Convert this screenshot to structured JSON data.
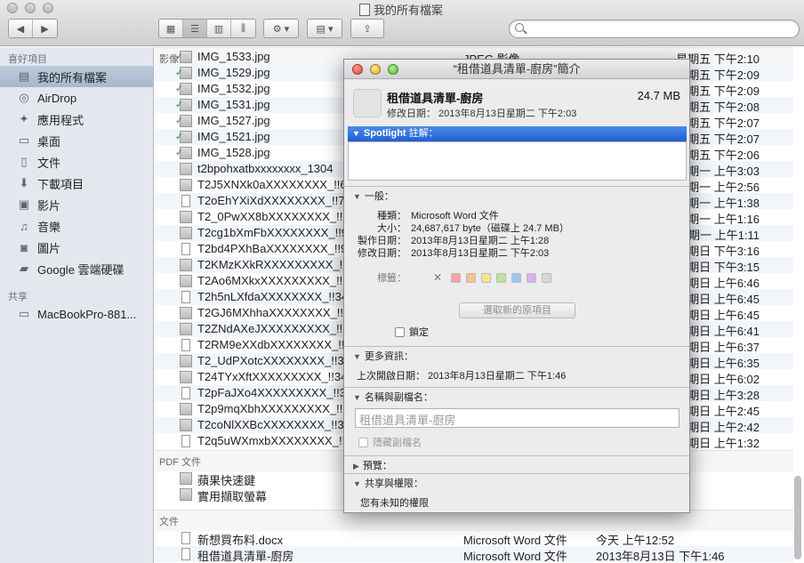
{
  "window": {
    "title": "我的所有檔案"
  },
  "sidebar": {
    "favorites_header": "喜好項目",
    "favorites": [
      {
        "label": "我的所有檔案",
        "icon": "all-files-icon",
        "selected": true
      },
      {
        "label": "AirDrop",
        "icon": "airdrop-icon"
      },
      {
        "label": "應用程式",
        "icon": "applications-icon"
      },
      {
        "label": "桌面",
        "icon": "desktop-icon"
      },
      {
        "label": "文件",
        "icon": "documents-icon"
      },
      {
        "label": "下載項目",
        "icon": "downloads-icon"
      },
      {
        "label": "影片",
        "icon": "movies-icon"
      },
      {
        "label": "音樂",
        "icon": "music-icon"
      },
      {
        "label": "圖片",
        "icon": "pictures-icon"
      },
      {
        "label": "Google 雲端硬碟",
        "icon": "folder-icon"
      }
    ],
    "shared_header": "共享",
    "shared": [
      {
        "label": "MacBookPro-881...",
        "icon": "computer-icon"
      }
    ]
  },
  "list": {
    "images_section": "影像",
    "image_rows": [
      {
        "name": "IMG_1533.jpg",
        "kind": "JPEG 影像",
        "date": "星期五 下午2:10"
      },
      {
        "name": "IMG_1529.jpg",
        "date": "星期五 下午2:09"
      },
      {
        "name": "IMG_1532.jpg",
        "date": "星期五 下午2:09"
      },
      {
        "name": "IMG_1531.jpg",
        "date": "星期五 下午2:08"
      },
      {
        "name": "IMG_1527.jpg",
        "date": "星期五 下午2:07"
      },
      {
        "name": "IMG_1521.jpg",
        "date": "星期五 下午2:07"
      },
      {
        "name": "IMG_1528.jpg",
        "date": "星期五 下午2:06"
      },
      {
        "name": "t2bpohxatbxxxxxxxx_1304",
        "date": "星期一 上午3:03"
      },
      {
        "name": "T2J5XNXk0aXXXXXXXX_!!639",
        "date": "星期一 上午2:56"
      },
      {
        "name": "T2oEhYXiXdXXXXXXXX_!!734",
        "date": "星期一 上午1:38"
      },
      {
        "name": "T2_0PwXX8bXXXXXXXX_!!92",
        "date": "星期一 上午1:16"
      },
      {
        "name": "T2cg1bXmFbXXXXXXXX_!!92",
        "date": "星期一 上午1:11"
      },
      {
        "name": "T2bd4PXhBaXXXXXXXX_!!92",
        "date": "星期日 下午3:16"
      },
      {
        "name": "T2KMzKXkRXXXXXXXXX_!!92",
        "date": "星期日 下午3:15"
      },
      {
        "name": "T2Ao6MXkxXXXXXXXXX_!!92",
        "date": "星期日 上午6:46"
      },
      {
        "name": "T2h5nLXfdaXXXXXXXX_!!345",
        "date": "星期日 上午6:45"
      },
      {
        "name": "T2GJ6MXhhaXXXXXXXX_!!34",
        "date": "星期日 上午6:45"
      },
      {
        "name": "T2ZNdAXeJXXXXXXXXX_!!345",
        "date": "星期日 上午6:41"
      },
      {
        "name": "T2RM9eXXdbXXXXXXXX_!!34",
        "date": "星期日 上午6:37"
      },
      {
        "name": "T2_UdPXotcXXXXXXXX_!!345",
        "date": "星期日 上午6:35"
      },
      {
        "name": "T24TYxXftXXXXXXXXX_!!345",
        "date": "星期日 上午6:02"
      },
      {
        "name": "T2pFaJXo4XXXXXXXXX_!!338",
        "date": "星期日 上午3:28"
      },
      {
        "name": "T2p9mqXbhXXXXXXXXX_!!33",
        "date": "星期日 上午2:45"
      },
      {
        "name": "T2coNlXXBcXXXXXXXX_!!338",
        "date": "星期日 上午2:42"
      },
      {
        "name": "T2q5uWXmxbXXXXXXXX_!!33",
        "date": "星期日 上午1:32"
      }
    ],
    "pdf_section": "PDF 文件",
    "pdf_rows": [
      {
        "name": "蘋果快速鍵"
      },
      {
        "name": "實用擷取螢幕"
      }
    ],
    "doc_section": "文件",
    "doc_rows": [
      {
        "name": "新想買布料.docx",
        "kind": "Microsoft Word 文件",
        "date": "今天 上午12:52"
      },
      {
        "name": "租借道具清單-廚房",
        "kind": "Microsoft Word 文件",
        "date": "2013年8月13日 下午1:46"
      }
    ]
  },
  "info": {
    "title": "“租借道具清單-廚房”簡介",
    "name": "租借道具清單-廚房",
    "size": "24.7 MB",
    "modified_line": "修改日期：  2013年8月13日星期二 下午2:03",
    "spotlight_label": "Spotlight",
    "spotlight_suffix": "註解：",
    "general_label": "一般：",
    "kind_k": "種類：",
    "kind_v": "Microsoft Word 文件",
    "size_k": "大小：",
    "size_v": "24,687,617 byte（磁碟上 24.7 MB）",
    "created_k": "製作日期：",
    "created_v": "2013年8月13日星期二 上午1:28",
    "modified_k": "修改日期：",
    "modified_v": "2013年8月13日星期二 下午2:03",
    "tags_label": "標籤：",
    "select_original": "選取新的原項目",
    "locked": "鎖定",
    "more_label": "更多資訊：",
    "last_opened": "上次開啟日期：  2013年8月13日星期二 下午1:46",
    "name_ext_label": "名稱與副檔名：",
    "name_field": "租借道具清單-廚房",
    "hide_ext": "隱藏副檔名",
    "preview_label": "預覽：",
    "sharing_label": "共享與權限：",
    "permissions": "您有未知的權限",
    "tag_colors": [
      "#f3a4a4",
      "#f6c48d",
      "#f5e58c",
      "#bde49a",
      "#9dc6f2",
      "#d8b2ef",
      "#d7d7d7"
    ]
  }
}
